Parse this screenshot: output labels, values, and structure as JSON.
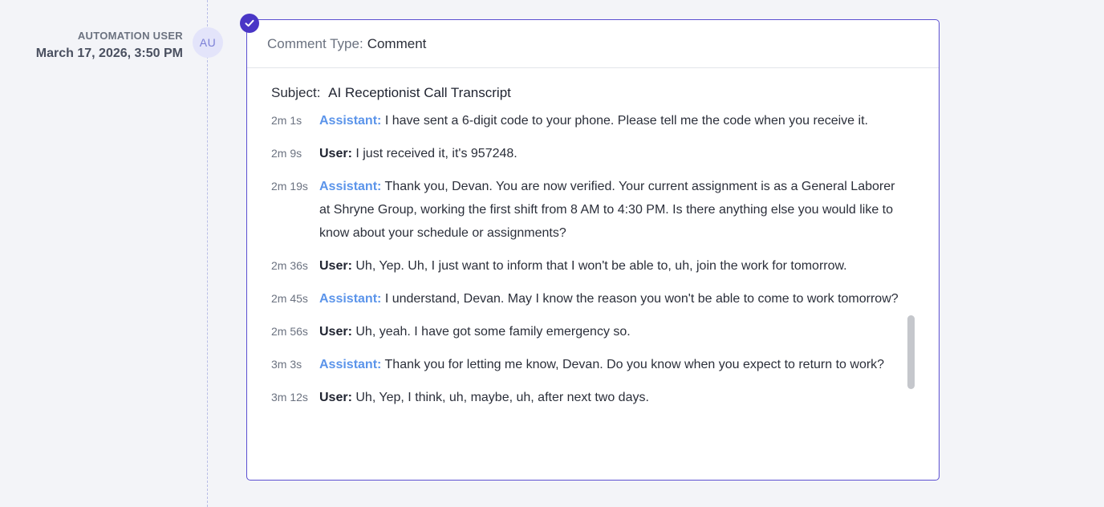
{
  "author": {
    "name": "AUTOMATION USER",
    "initials": "AU",
    "timestamp": "March 17, 2026, 3:50 PM"
  },
  "comment": {
    "type_label": "Comment Type:",
    "type_value": "Comment",
    "subject_label": "Subject:",
    "subject_value": "AI Receptionist Call Transcript",
    "transcript": [
      {
        "time": "2m 1s",
        "speaker": "Assistant:",
        "role": "assistant",
        "text": "I have sent a 6-digit code to your phone. Please tell me the code when you receive it."
      },
      {
        "time": "2m 9s",
        "speaker": "User:",
        "role": "user",
        "text": "I just received it, it's 957248."
      },
      {
        "time": "2m 19s",
        "speaker": "Assistant:",
        "role": "assistant",
        "text": "Thank you, Devan. You are now verified. Your current assignment is as a General Laborer at Shryne Group, working the first shift from 8 AM to 4:30 PM. Is there anything else you would like to know about your schedule or assignments?"
      },
      {
        "time": "2m 36s",
        "speaker": "User:",
        "role": "user",
        "text": "Uh, Yep. Uh, I just want to inform that I won't be able to, uh, join the work for tomorrow."
      },
      {
        "time": "2m 45s",
        "speaker": "Assistant:",
        "role": "assistant",
        "text": "I understand, Devan. May I know the reason you won't be able to come to work tomorrow?"
      },
      {
        "time": "2m 56s",
        "speaker": "User:",
        "role": "user",
        "text": "Uh, yeah. I have got some family emergency so."
      },
      {
        "time": "3m 3s",
        "speaker": "Assistant:",
        "role": "assistant",
        "text": "Thank you for letting me know, Devan. Do you know when you expect to return to work?"
      },
      {
        "time": "3m 12s",
        "speaker": "User:",
        "role": "user",
        "text": "Uh, Yep, I think, uh, maybe, uh, after next two days."
      }
    ]
  },
  "icons": {
    "status": "check-circle-icon"
  },
  "colors": {
    "accent": "#4936c6",
    "assistant_speaker": "#5b94ea",
    "card_border": "#5b4fd1"
  }
}
